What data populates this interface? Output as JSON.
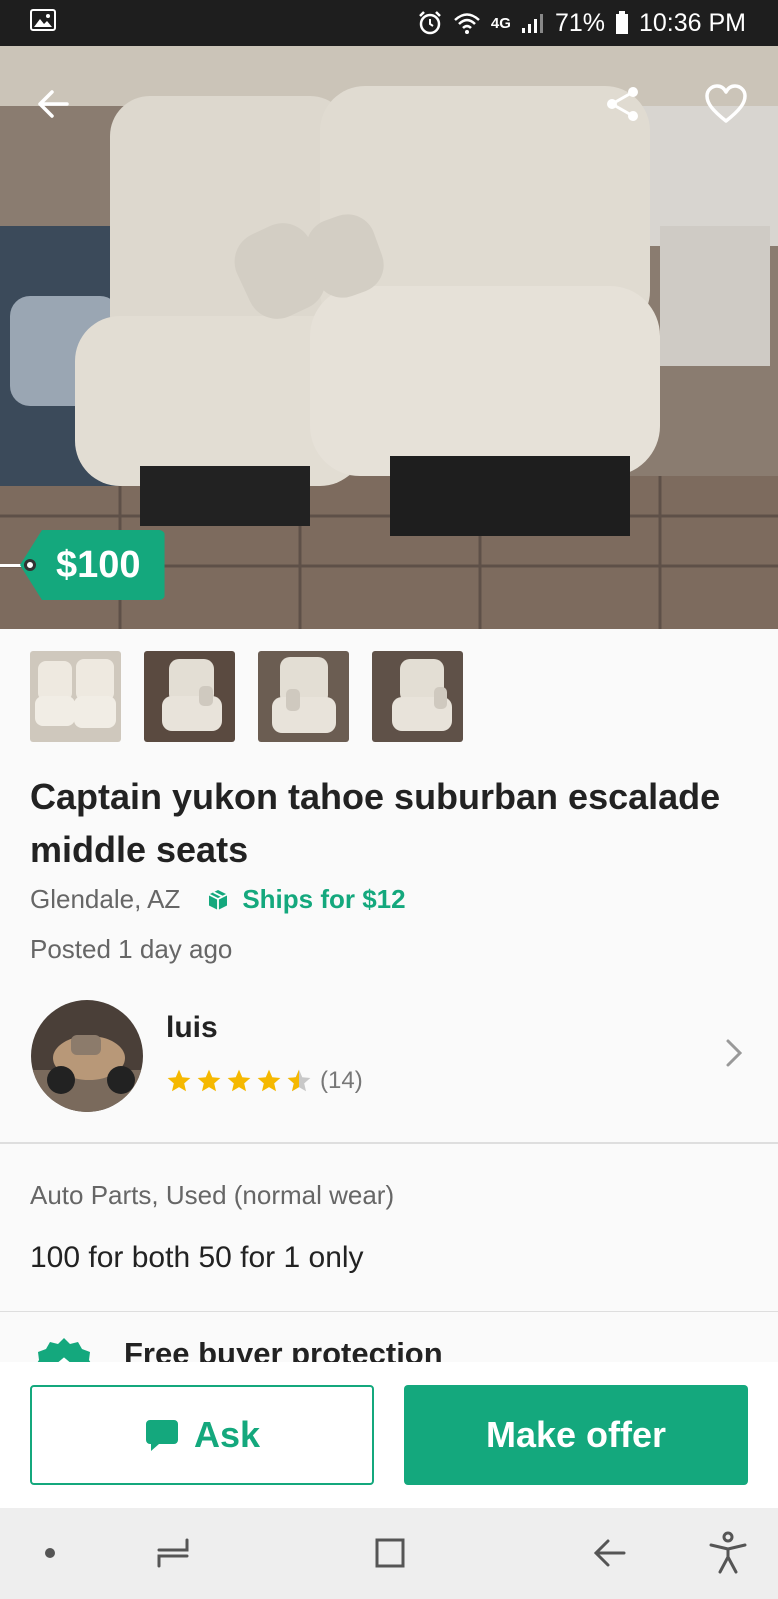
{
  "status_bar": {
    "battery": "71%",
    "time": "10:36 PM",
    "network": "4G",
    "icons": [
      "image-icon",
      "alarm-icon",
      "wifi-icon",
      "signal-icon",
      "battery-icon"
    ]
  },
  "hero": {
    "price": "$100",
    "icons": [
      "back-arrow-icon",
      "share-icon",
      "heart-icon"
    ]
  },
  "listing": {
    "title": "Captain yukon tahoe suburban escalade middle seats",
    "location": "Glendale, AZ",
    "shipping": "Ships for $12",
    "posted": "Posted 1 day ago",
    "category_condition": "Auto Parts, Used (normal wear)",
    "description": "100 for both 50 for 1 only",
    "thumbnails": 4
  },
  "seller": {
    "name": "luis",
    "rating": 4.5,
    "review_count": "(14)"
  },
  "protection": {
    "label": "Free buyer protection"
  },
  "actions": {
    "ask_label": "Ask",
    "offer_label": "Make offer"
  },
  "colors": {
    "accent": "#14a87d",
    "star": "#f5b800",
    "status_bar": "#1e1e1e"
  }
}
